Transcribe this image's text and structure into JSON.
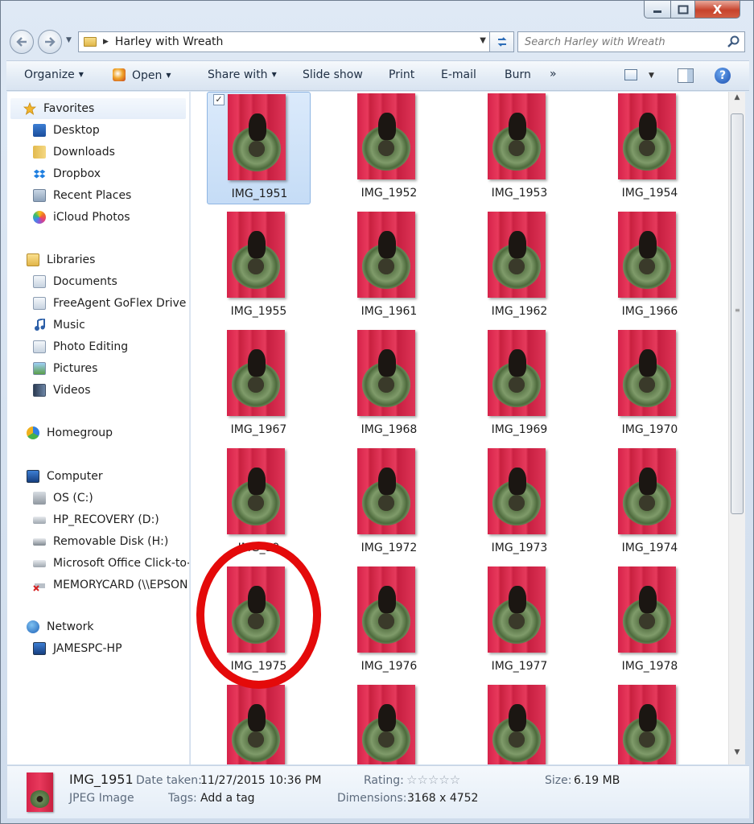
{
  "window": {
    "close_glyph": "X"
  },
  "address": {
    "crumb": "Harley with Wreath",
    "search_placeholder": "Search Harley with Wreath"
  },
  "toolbar": {
    "organize": "Organize",
    "open": "Open",
    "share_with": "Share with",
    "slide_show": "Slide show",
    "print": "Print",
    "email": "E-mail",
    "burn": "Burn",
    "more": "»",
    "help": "?"
  },
  "nav": {
    "favorites": {
      "header": "Favorites",
      "items": [
        "Desktop",
        "Downloads",
        "Dropbox",
        "Recent Places",
        "iCloud Photos"
      ]
    },
    "libraries": {
      "header": "Libraries",
      "items": [
        "Documents",
        "FreeAgent GoFlex Drive (F",
        "Music",
        "Photo Editing",
        "Pictures",
        "Videos"
      ]
    },
    "homegroup": "Homegroup",
    "computer": {
      "header": "Computer",
      "items": [
        "OS (C:)",
        "HP_RECOVERY (D:)",
        "Removable Disk (H:)",
        "Microsoft Office Click-to-",
        "MEMORYCARD (\\\\EPSON"
      ]
    },
    "network": {
      "header": "Network",
      "items": [
        "JAMESPC-HP"
      ]
    }
  },
  "files": [
    "IMG_1951",
    "IMG_1952",
    "IMG_1953",
    "IMG_1954",
    "IMG_1955",
    "IMG_1961",
    "IMG_1962",
    "IMG_1966",
    "IMG_1967",
    "IMG_1968",
    "IMG_1969",
    "IMG_1970",
    "IMG_19",
    "IMG_1972",
    "IMG_1973",
    "IMG_1974",
    "IMG_1975",
    "IMG_1976",
    "IMG_1977",
    "IMG_1978",
    "",
    "",
    "",
    ""
  ],
  "selected_file": "IMG_1951",
  "details": {
    "name": "IMG_1951",
    "type": "JPEG Image",
    "date_taken_label": "Date taken:",
    "date_taken": "11/27/2015 10:36 PM",
    "tags_label": "Tags:",
    "tags_value": "Add a tag",
    "rating_label": "Rating:",
    "rating_value": 0,
    "rating_max": 5,
    "dimensions_label": "Dimensions:",
    "dimensions": "3168 x 4752",
    "size_label": "Size:",
    "size": "6.19 MB"
  },
  "colors": {
    "annotation_circle": "#e40a0a",
    "selection_bg": "#c5dcf6",
    "background_photo_red": "#df3457"
  }
}
